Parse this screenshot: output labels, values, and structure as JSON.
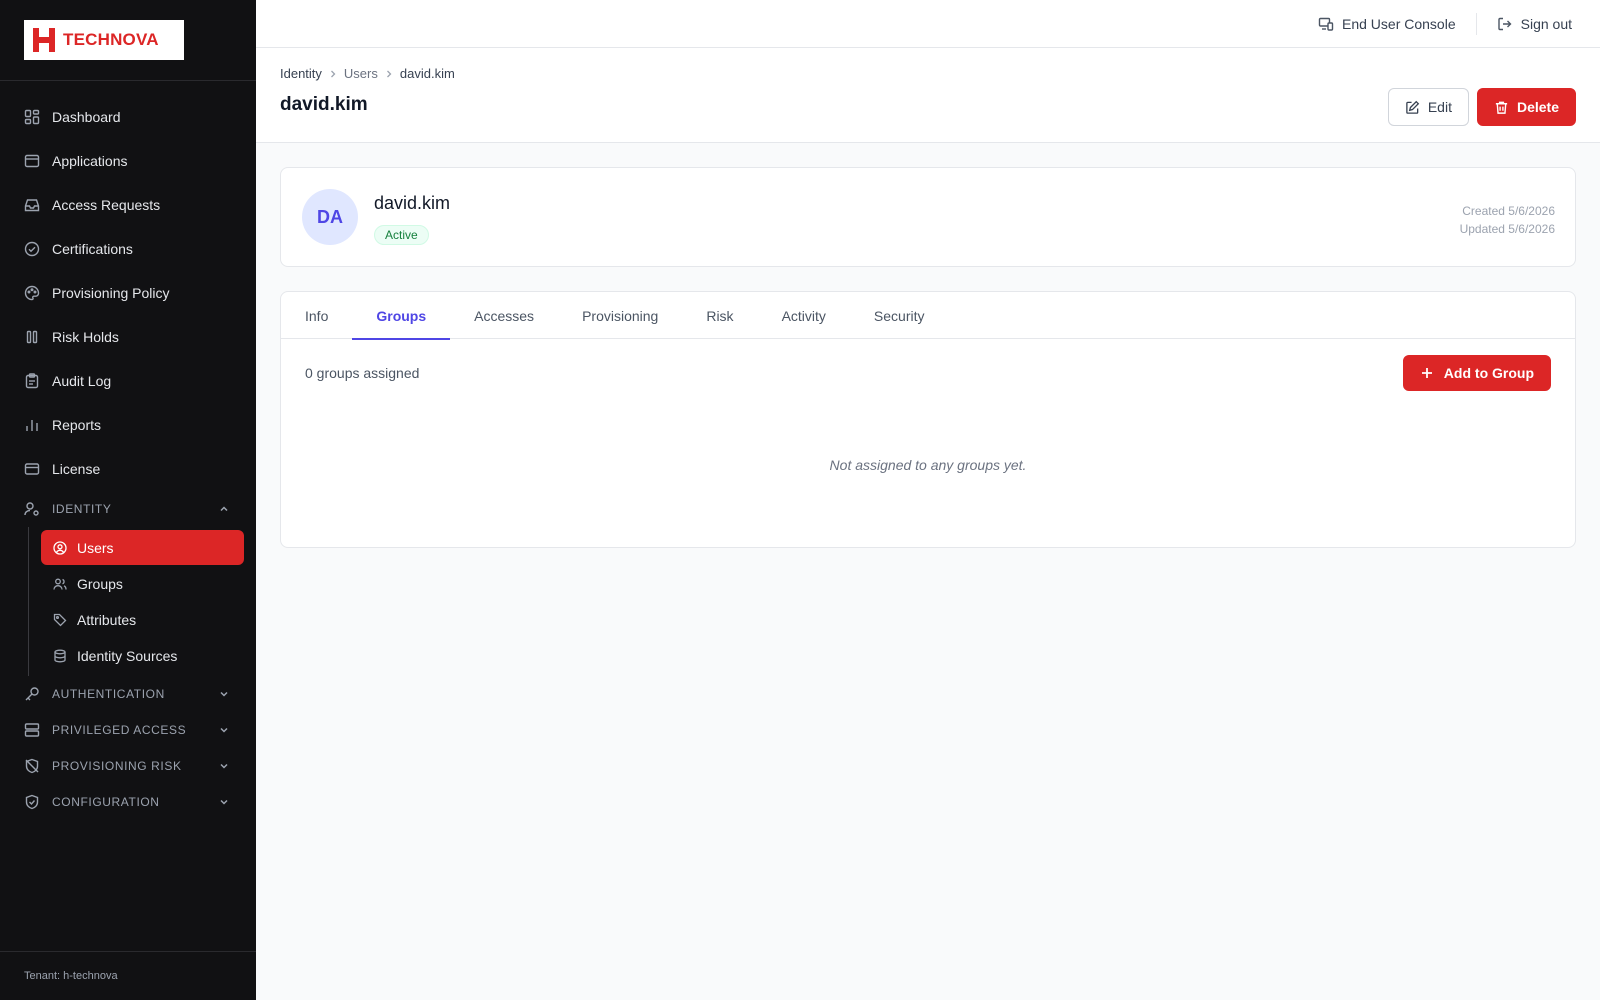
{
  "brand": {
    "name": "TECHNOVA",
    "accent": "#dc2626"
  },
  "sidebar": {
    "items": [
      {
        "label": "Dashboard",
        "icon": "dashboard-icon"
      },
      {
        "label": "Applications",
        "icon": "window-icon"
      },
      {
        "label": "Access Requests",
        "icon": "inbox-icon"
      },
      {
        "label": "Certifications",
        "icon": "check-circle-icon"
      },
      {
        "label": "Provisioning Policy",
        "icon": "palette-icon"
      },
      {
        "label": "Risk Holds",
        "icon": "pause-icon"
      },
      {
        "label": "Audit Log",
        "icon": "clipboard-icon"
      },
      {
        "label": "Reports",
        "icon": "bar-chart-icon"
      },
      {
        "label": "License",
        "icon": "card-icon"
      }
    ],
    "identity_section": {
      "label": "IDENTITY",
      "items": [
        {
          "label": "Users",
          "active": true
        },
        {
          "label": "Groups"
        },
        {
          "label": "Attributes"
        },
        {
          "label": "Identity Sources"
        }
      ]
    },
    "sections": [
      {
        "label": "AUTHENTICATION"
      },
      {
        "label": "PRIVILEGED ACCESS"
      },
      {
        "label": "PROVISIONING RISK"
      },
      {
        "label": "CONFIGURATION"
      }
    ],
    "tenant": "Tenant: h-technova"
  },
  "topbar": {
    "console_label": "End User Console",
    "signout_label": "Sign out"
  },
  "header": {
    "breadcrumb": [
      "Identity",
      "Users",
      "david.kim"
    ],
    "title": "david.kim",
    "edit_label": "Edit",
    "delete_label": "Delete"
  },
  "profile": {
    "initials": "DA",
    "name": "david.kim",
    "status": "Active",
    "created": "Created 5/6/2026",
    "updated": "Updated 5/6/2026"
  },
  "tabs": [
    "Info",
    "Groups",
    "Accesses",
    "Provisioning",
    "Risk",
    "Activity",
    "Security"
  ],
  "active_tab": "Groups",
  "groups": {
    "count_text": "0 groups assigned",
    "add_label": "Add to Group",
    "empty_text": "Not assigned to any groups yet."
  }
}
